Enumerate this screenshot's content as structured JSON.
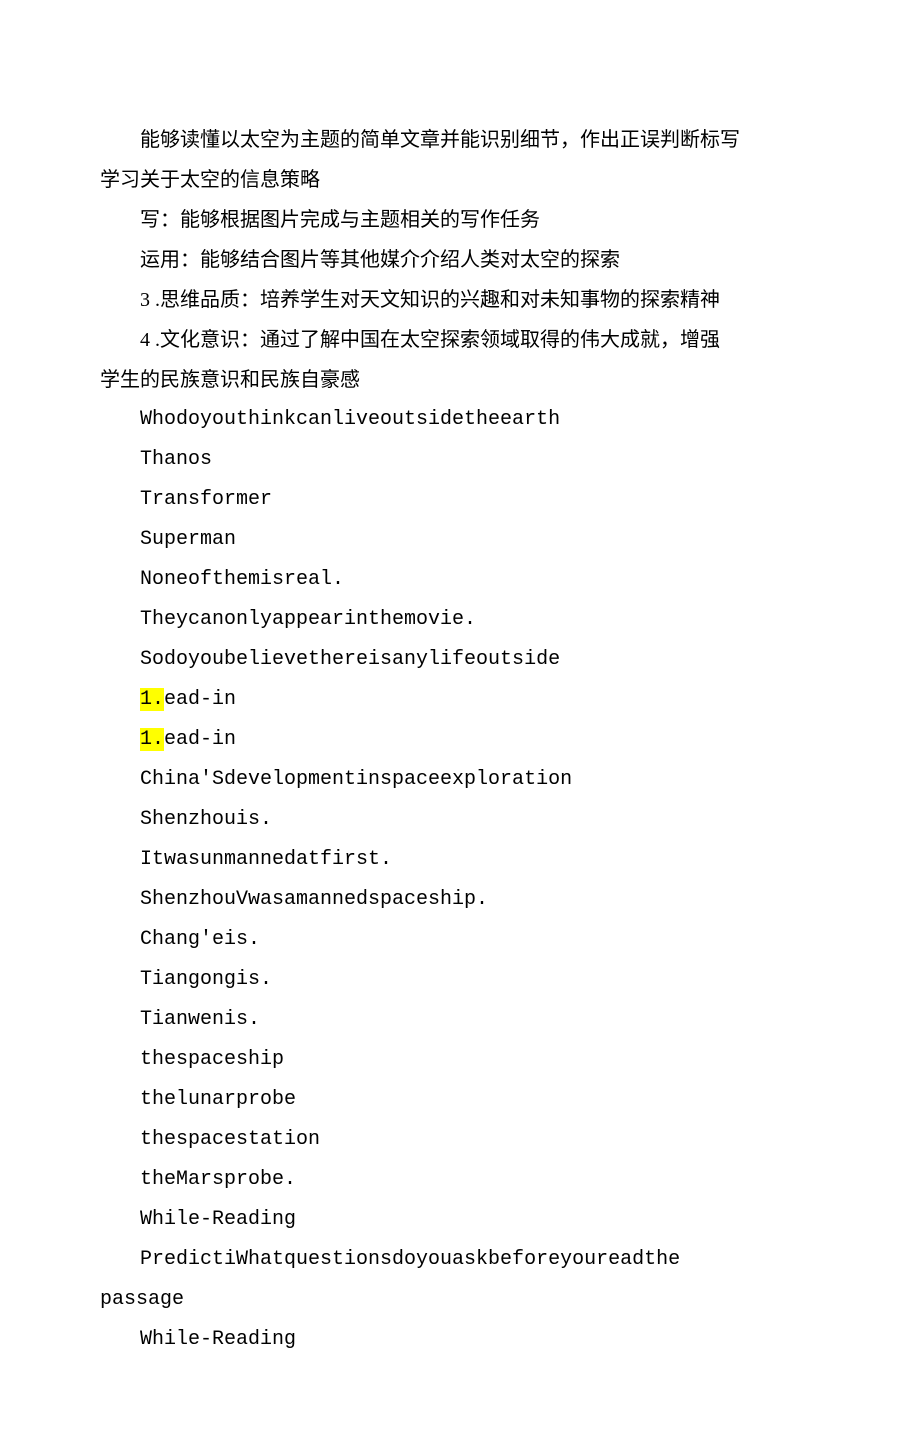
{
  "lines": [
    {
      "cls": "para",
      "text": "能够读懂以太空为主题的简单文章并能识别细节，作出正误判断标写"
    },
    {
      "cls": "para-no-indent",
      "text": "学习关于太空的信息策略"
    },
    {
      "cls": "para",
      "text": "写：能够根据图片完成与主题相关的写作任务"
    },
    {
      "cls": "para",
      "text": "运用：能够结合图片等其他媒介介绍人类对太空的探索"
    },
    {
      "cls": "para",
      "text": "3 .思维品质：培养学生对天文知识的兴趣和对未知事物的探索精神"
    },
    {
      "cls": "para",
      "text": "4 .文化意识：通过了解中国在太空探索领域取得的伟大成就，增强"
    },
    {
      "cls": "para-no-indent",
      "text": "学生的民族意识和民族自豪感"
    },
    {
      "cls": "para mono",
      "text": "Whodoyouthinkcanliveoutsidetheearth"
    },
    {
      "cls": "para mono",
      "text": "Thanos"
    },
    {
      "cls": "para mono",
      "text": "Transformer"
    },
    {
      "cls": "para mono",
      "text": "Superman"
    },
    {
      "cls": "para mono",
      "text": "Noneofthemisreal."
    },
    {
      "cls": "para mono",
      "text": "Theycanonlyappearinthemovie."
    },
    {
      "cls": "para mono",
      "text": "Sodoyoubelievethereisanylifeoutside"
    },
    {
      "cls": "para mono",
      "hl_prefix": "1.",
      "text": "ead-in"
    },
    {
      "cls": "para mono",
      "hl_prefix": "1.",
      "text": "ead-in"
    },
    {
      "cls": "para mono",
      "text": "China'Sdevelopmentinspaceexploration"
    },
    {
      "cls": "para mono",
      "text": "Shenzhouis."
    },
    {
      "cls": "para mono",
      "text": "Itwasunmannedatfirst."
    },
    {
      "cls": "para mono",
      "text": "ShenzhouVwasamannedspaceship."
    },
    {
      "cls": "para mono",
      "text": "Chang'eis."
    },
    {
      "cls": "para mono",
      "text": "Tiangongis."
    },
    {
      "cls": "para mono",
      "text": "Tianwenis."
    },
    {
      "cls": "para mono",
      "text": "thespaceship"
    },
    {
      "cls": "para mono",
      "text": "thelunarprobe"
    },
    {
      "cls": "para mono",
      "text": "thespacestation"
    },
    {
      "cls": "para mono",
      "text": "theMarsprobe."
    },
    {
      "cls": "para mono",
      "text": "While-Reading"
    },
    {
      "cls": "para mono",
      "text": "PredictiWhatquestionsdoyouaskbeforeyoureadthe"
    },
    {
      "cls": "para-no-indent mono",
      "text": "passage"
    },
    {
      "cls": "para mono",
      "text": "While-Reading"
    }
  ]
}
